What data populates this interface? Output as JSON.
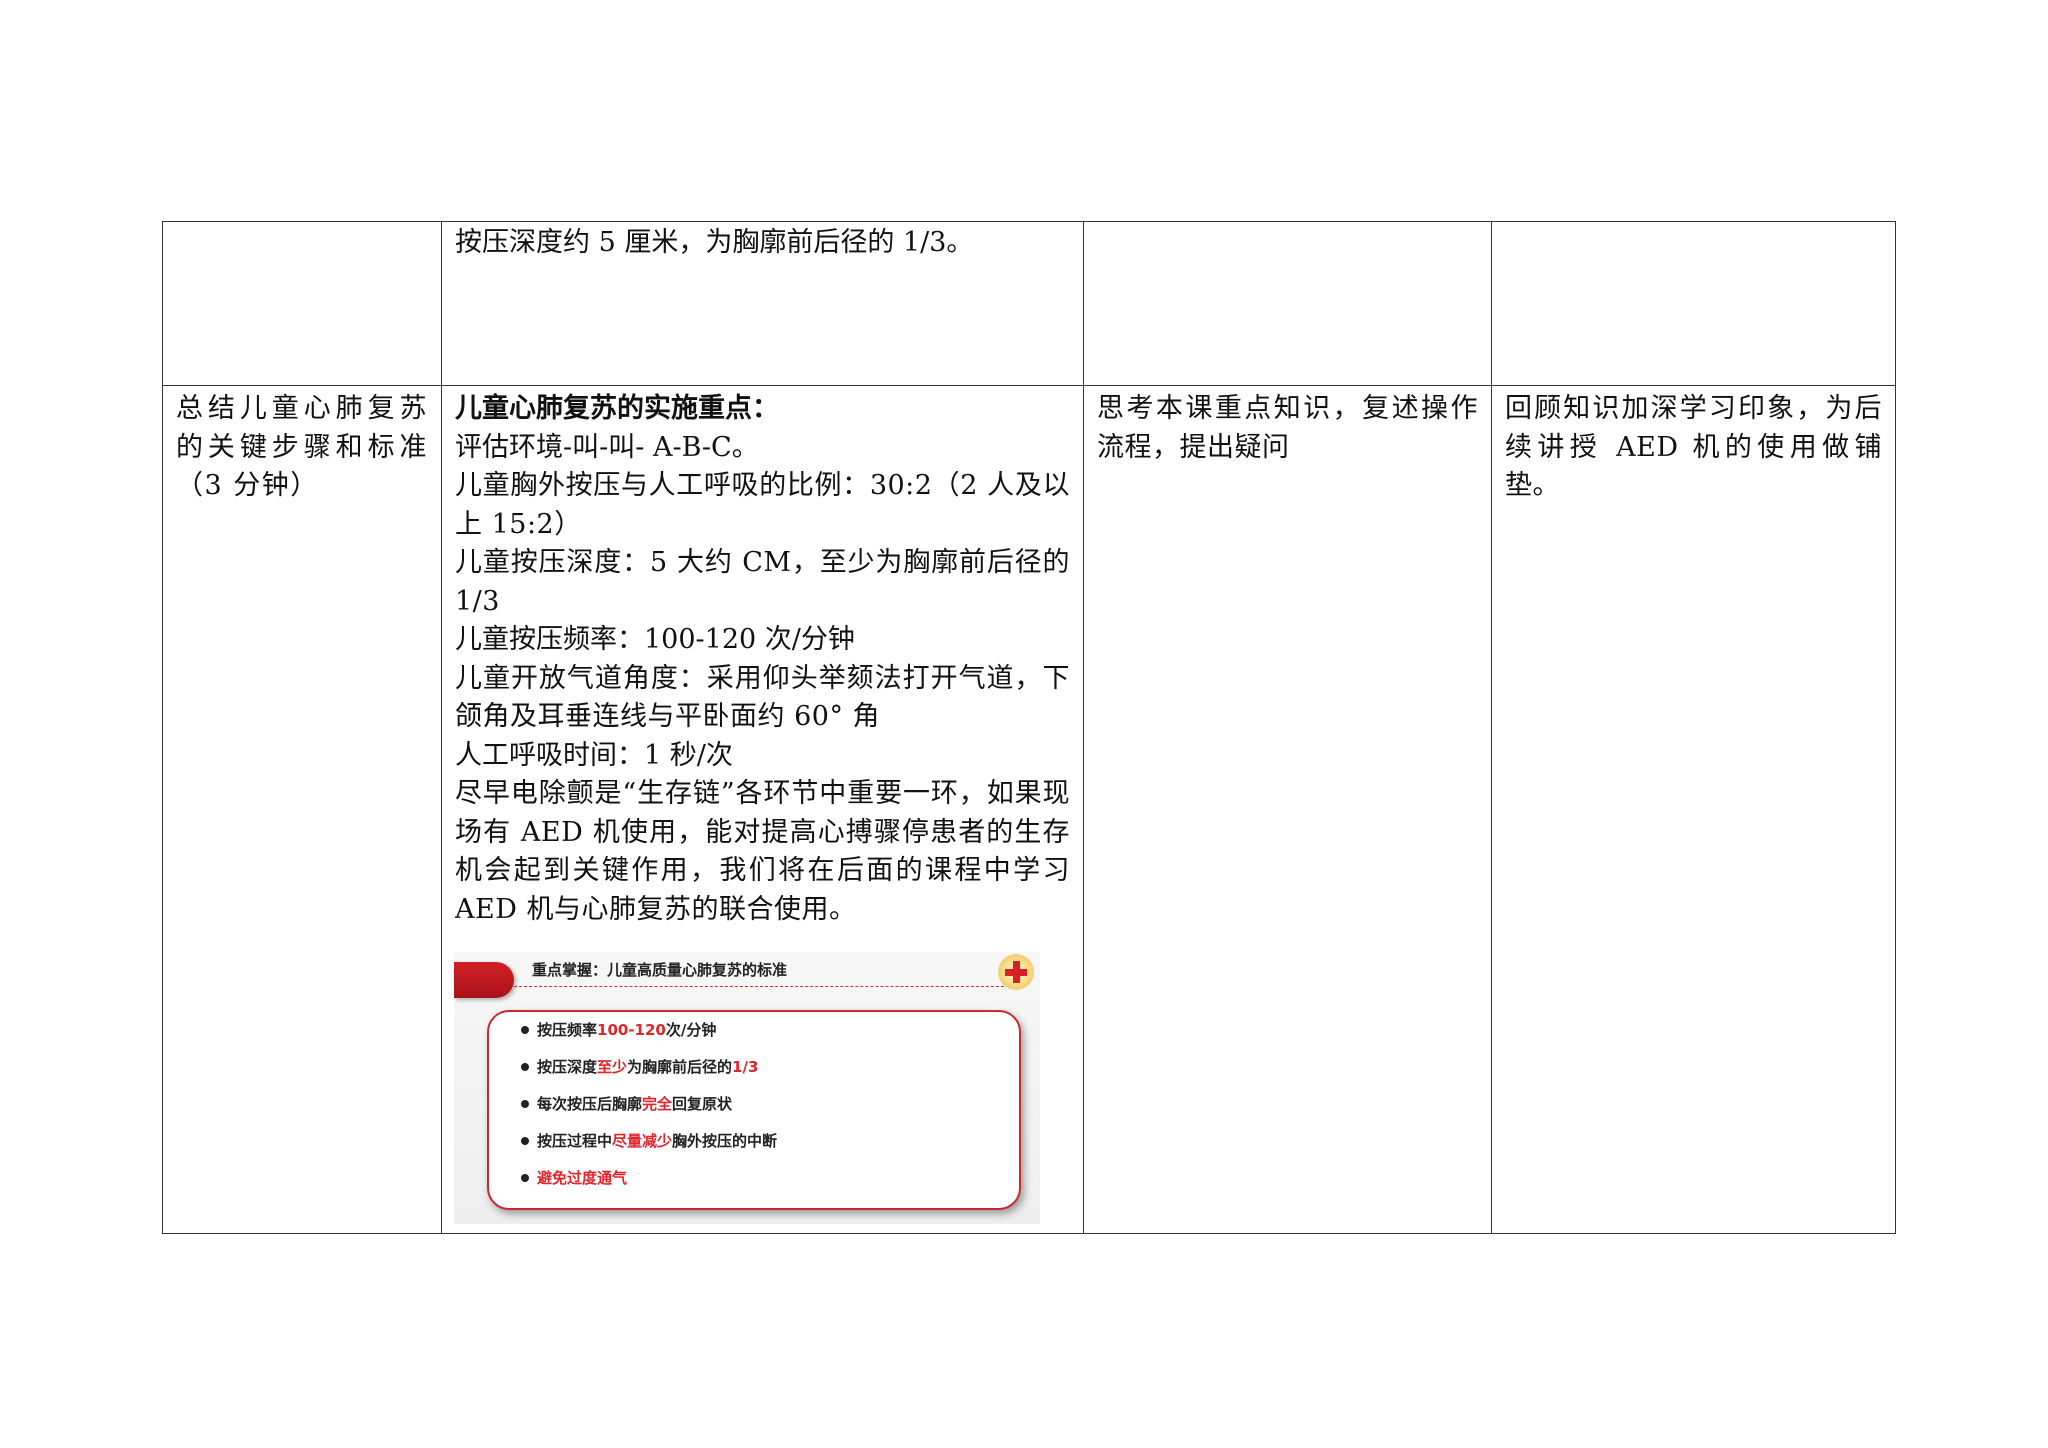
{
  "row1": {
    "col1": "",
    "col2": "按压深度约 5 厘米，为胸廓前后径的 1/3。",
    "col3": "",
    "col4": ""
  },
  "row2": {
    "col1": "总结儿童心肺复苏的关键步骤和标准（3 分钟）",
    "col2": {
      "heading": "儿童心肺复苏的实施重点：",
      "lines": [
        "评估环境-叫-叫- A-B-C。",
        "儿童胸外按压与人工呼吸的比例：30:2（2 人及以上 15:2）",
        "儿童按压深度：5 大约 CM，至少为胸廓前后径的 1/3",
        "儿童按压频率：100-120 次/分钟",
        "儿童开放气道角度：采用仰头举颏法打开气道，下颌角及耳垂连线与平卧面约 60° 角",
        "人工呼吸时间：1 秒/次",
        "尽早电除颤是“生存链”各环节中重要一环，如果现场有 AED 机使用，能对提高心搏骤停患者的生存机会起到关键作用，我们将在后面的课程中学习 AED 机与心肺复苏的联合使用。"
      ],
      "slide": {
        "title": "重点掌握：儿童高质量心肺复苏的标准",
        "badge_icon": "red-cross-icon",
        "items": [
          {
            "pre": "按压频率",
            "hl": "100-120",
            "post": "次/分钟"
          },
          {
            "pre": "按压深度",
            "hl": "至少",
            "post": "为胸廓前后径的",
            "hl2": "1/3"
          },
          {
            "pre": "每次按压后胸廓",
            "hl": "完全",
            "post": "回复原状"
          },
          {
            "pre": "按压过程中",
            "hl": "尽量减少",
            "post": "胸外按压的中断"
          },
          {
            "pre": "",
            "hl": "避免过度通气",
            "post": ""
          }
        ],
        "accent_color": "#e0242b"
      }
    },
    "col3": "思考本课重点知识，复述操作流程，提出疑问",
    "col4": "回顾知识加深学习印象，为后续讲授 AED 机的使用做铺垫。"
  }
}
